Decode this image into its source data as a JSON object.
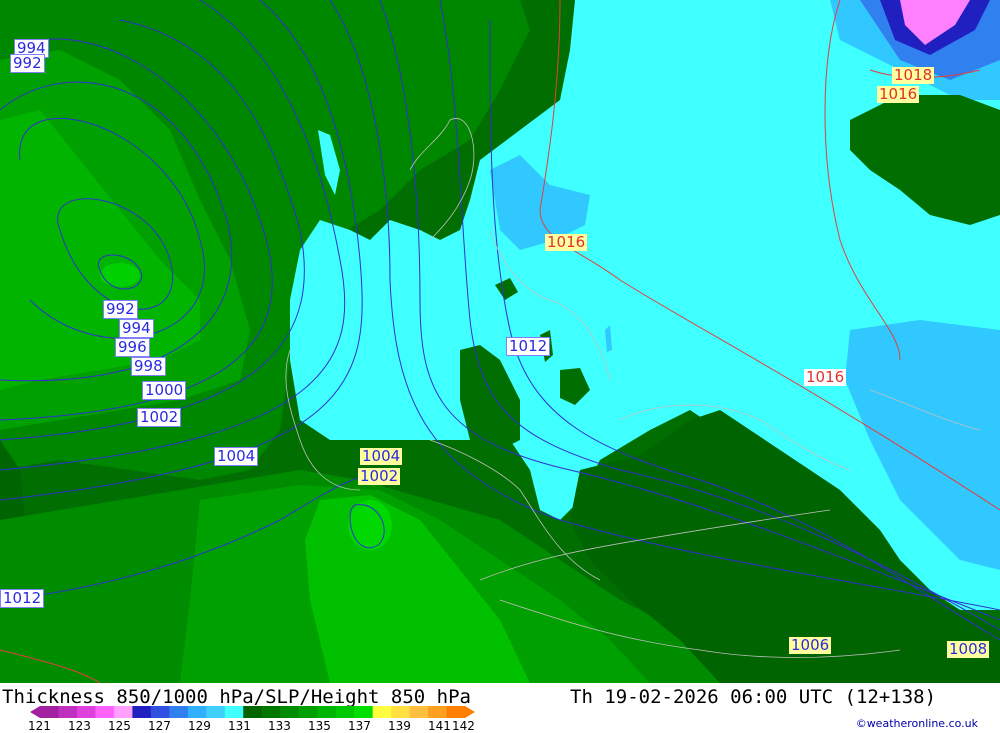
{
  "title": "Thickness 850/1000 hPa/SLP/Height 850 hPa",
  "datetime": "Th 19-02-2026 06:00 UTC (12+138)",
  "credit": "©weatheronline.co.uk",
  "scale": {
    "ticks": [
      "121",
      "123",
      "125",
      "127",
      "129",
      "131",
      "133",
      "135",
      "137",
      "139",
      "141",
      "142"
    ],
    "colors": [
      "#a020a0",
      "#c030c0",
      "#e040e0",
      "#ff60ff",
      "#ffa0ff",
      "#2020c0",
      "#3050e0",
      "#3080f0",
      "#30b0ff",
      "#40d0ff",
      "#40ffff",
      "#006400",
      "#007800",
      "#008c00",
      "#00a000",
      "#00b400",
      "#00c800",
      "#00e000",
      "#ffff40",
      "#ffe040",
      "#ffc040",
      "#ffa020",
      "#ff8000"
    ]
  },
  "isobar_labels": [
    {
      "text": "994",
      "style": "blue"
    },
    {
      "text": "992",
      "style": "blue"
    },
    {
      "text": "992",
      "style": "blue"
    },
    {
      "text": "994",
      "style": "blue"
    },
    {
      "text": "996",
      "style": "blue"
    },
    {
      "text": "998",
      "style": "blue"
    },
    {
      "text": "1000",
      "style": "blue"
    },
    {
      "text": "1002",
      "style": "blue"
    },
    {
      "text": "1004",
      "style": "blue"
    },
    {
      "text": "1004",
      "style": "yellow"
    },
    {
      "text": "1002",
      "style": "yellow"
    },
    {
      "text": "1012",
      "style": "blue"
    },
    {
      "text": "1012",
      "style": "blue"
    },
    {
      "text": "1016",
      "style": "red"
    },
    {
      "text": "1016",
      "style": "red2"
    },
    {
      "text": "1018",
      "style": "red"
    },
    {
      "text": "1016",
      "style": "red"
    },
    {
      "text": "1006",
      "style": "yellow"
    },
    {
      "text": "1008",
      "style": "yellow"
    }
  ]
}
